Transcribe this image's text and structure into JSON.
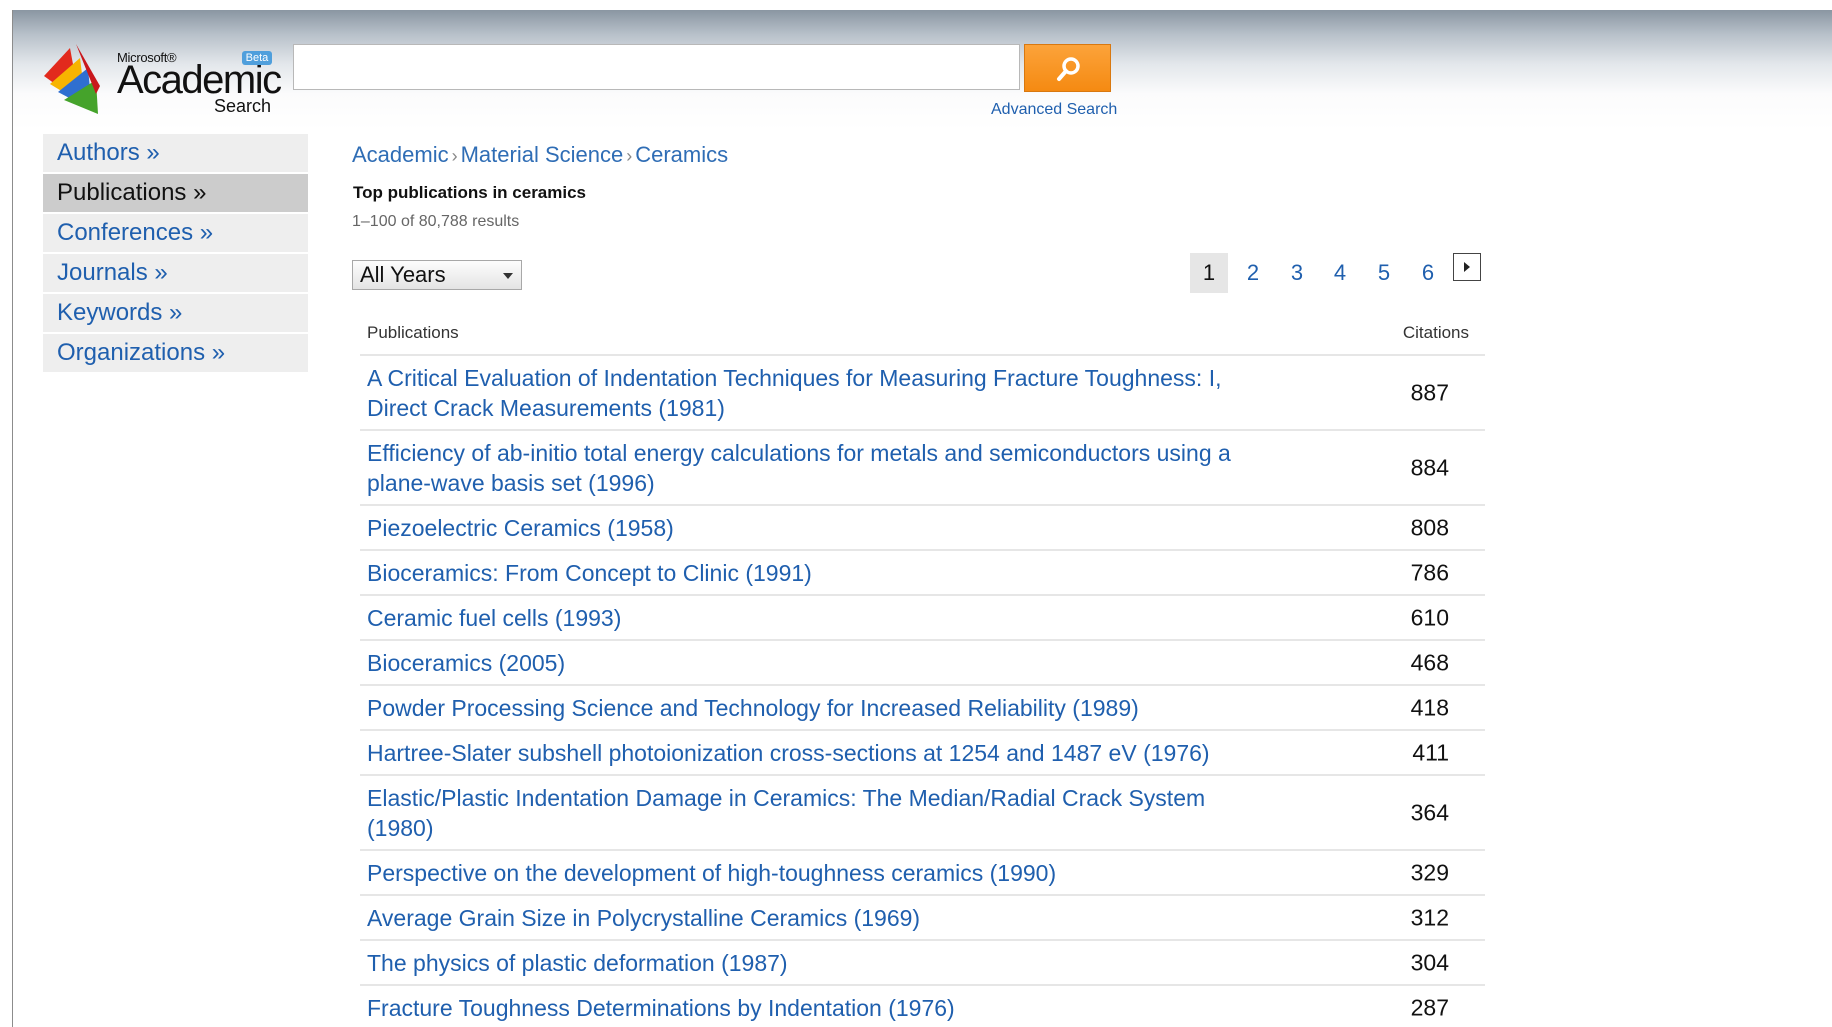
{
  "logo": {
    "microsoft": "Microsoft®",
    "academic": "Academic",
    "search": "Search",
    "beta": "Beta"
  },
  "search": {
    "value": "",
    "placeholder": "",
    "button_icon": "search-icon",
    "advanced_link": "Advanced Search"
  },
  "sidebar": {
    "items": [
      {
        "label": "Authors »",
        "active": false
      },
      {
        "label": "Publications »",
        "active": true
      },
      {
        "label": "Conferences »",
        "active": false
      },
      {
        "label": "Journals »",
        "active": false
      },
      {
        "label": "Keywords »",
        "active": false
      },
      {
        "label": "Organizations »",
        "active": false
      }
    ]
  },
  "breadcrumb": {
    "items": [
      "Academic",
      "Material Science",
      "Ceramics"
    ],
    "separator": "›"
  },
  "main": {
    "title": "Top publications in ceramics",
    "result_count": "1–100 of 80,788 results",
    "year_filter": "All Years"
  },
  "pager": {
    "pages": [
      "1",
      "2",
      "3",
      "4",
      "5",
      "6"
    ],
    "current": "1",
    "next_icon": "next-arrow-icon"
  },
  "table": {
    "col_publications": "Publications",
    "col_citations": "Citations",
    "rows": [
      {
        "title": "A Critical Evaluation of Indentation Techniques for Measuring Fracture Toughness: I, Direct Crack Measurements (1981)",
        "citations": "887"
      },
      {
        "title": "Efficiency of ab-initio total energy calculations for metals and semiconductors using a plane-wave basis set (1996)",
        "citations": "884"
      },
      {
        "title": "Piezoelectric Ceramics (1958)",
        "citations": "808"
      },
      {
        "title": "Bioceramics: From Concept to Clinic (1991)",
        "citations": "786"
      },
      {
        "title": "Ceramic fuel cells (1993)",
        "citations": "610"
      },
      {
        "title": "Bioceramics (2005)",
        "citations": "468"
      },
      {
        "title": "Powder Processing Science and Technology for Increased Reliability (1989)",
        "citations": "418"
      },
      {
        "title": "Hartree-Slater subshell photoionization cross-sections at 1254 and 1487 eV (1976)",
        "citations": "411"
      },
      {
        "title": "Elastic/Plastic Indentation Damage in Ceramics: The Median/Radial Crack System (1980)",
        "citations": "364"
      },
      {
        "title": "Perspective on the development of high-toughness ceramics (1990)",
        "citations": "329"
      },
      {
        "title": "Average Grain Size in Polycrystalline Ceramics (1969)",
        "citations": "312"
      },
      {
        "title": "The physics of plastic deformation (1987)",
        "citations": "304"
      },
      {
        "title": "Fracture Toughness Determinations by Indentation (1976)",
        "citations": "287"
      }
    ]
  },
  "colors": {
    "link": "#1f5fae",
    "search_button": "#f58a12",
    "active_nav": "#cccccc"
  }
}
